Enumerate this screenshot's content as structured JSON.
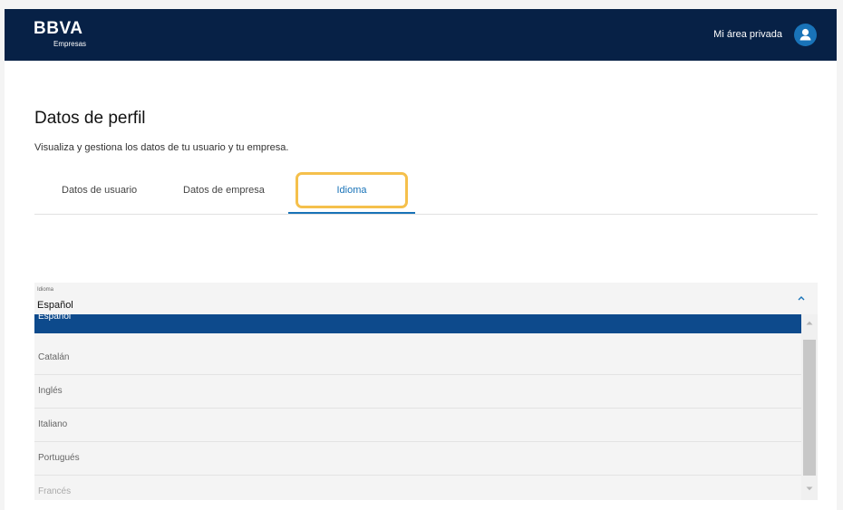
{
  "header": {
    "brand": "BBVA",
    "brand_sub": "Empresas",
    "private_area": "Mi área privada",
    "avatar_icon": "user-icon",
    "bg_color": "#072146"
  },
  "page": {
    "title": "Datos de perfil",
    "subtitle": "Visualiza y gestiona los datos de tu usuario y tu empresa."
  },
  "tabs": [
    {
      "label": "Datos de usuario",
      "active": false
    },
    {
      "label": "Datos de empresa",
      "active": false
    },
    {
      "label": "Idioma",
      "active": true
    }
  ],
  "language_select": {
    "label": "Idioma",
    "value": "Español",
    "chevron_icon": "chevron-up-icon",
    "options": [
      {
        "label": "Español",
        "selected": true
      },
      {
        "label": "Catalán",
        "selected": false
      },
      {
        "label": "Inglés",
        "selected": false
      },
      {
        "label": "Italiano",
        "selected": false
      },
      {
        "label": "Portugués",
        "selected": false
      },
      {
        "label": "Francés",
        "selected": false
      }
    ]
  },
  "colors": {
    "accent": "#1973b8",
    "selected_option": "#0d4a8c",
    "highlight": "#f5c04c"
  }
}
